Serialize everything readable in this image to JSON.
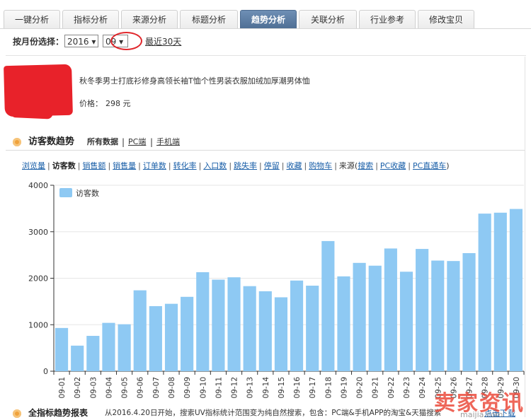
{
  "tabs": [
    {
      "label": "一键分析",
      "active": false
    },
    {
      "label": "指标分析",
      "active": false
    },
    {
      "label": "来源分析",
      "active": false
    },
    {
      "label": "标题分析",
      "active": false
    },
    {
      "label": "趋势分析",
      "active": true
    },
    {
      "label": "关联分析",
      "active": false
    },
    {
      "label": "行业参考",
      "active": false
    },
    {
      "label": "修改宝贝",
      "active": false
    }
  ],
  "month_select": {
    "label": "按月份选择：",
    "year": "2016",
    "month": "09",
    "recent_link": "最近30天"
  },
  "product": {
    "title": "秋冬季男士打底衫修身高领长袖T恤个性男装衣服加绒加厚潮男体恤",
    "price_label": "价格：",
    "price": "298 元"
  },
  "section": {
    "title": "访客数趋势",
    "segments": [
      {
        "label": "所有数据",
        "active": true
      },
      {
        "label": "PC端",
        "active": false
      },
      {
        "label": "手机端",
        "active": false
      }
    ]
  },
  "metrics": {
    "items": [
      {
        "label": "浏览量",
        "current": false
      },
      {
        "label": "访客数",
        "current": true
      },
      {
        "label": "销售额",
        "current": false
      },
      {
        "label": "销售量",
        "current": false
      },
      {
        "label": "订单数",
        "current": false
      },
      {
        "label": "转化率",
        "current": false
      },
      {
        "label": "入口数",
        "current": false
      },
      {
        "label": "跳失率",
        "current": false
      },
      {
        "label": "停留",
        "current": false
      },
      {
        "label": "收藏",
        "current": false
      },
      {
        "label": "购物车",
        "current": false
      }
    ],
    "source_prefix": "来源(",
    "source_items": [
      "搜索",
      "PC收藏",
      "PC直通车"
    ],
    "source_suffix": ")"
  },
  "chart_data": {
    "type": "bar",
    "series": [
      {
        "name": "访客数",
        "color": "#8ec9f3",
        "values": [
          930,
          550,
          760,
          1040,
          1010,
          1740,
          1400,
          1450,
          1600,
          2130,
          1970,
          2020,
          1830,
          1720,
          1590,
          1950,
          1840,
          2800,
          2040,
          2330,
          2270,
          2640,
          2140,
          2630,
          2380,
          2370,
          2540,
          3390,
          3410,
          3490
        ]
      }
    ],
    "categories": [
      "09-01",
      "09-02",
      "09-03",
      "09-04",
      "09-05",
      "09-06",
      "09-07",
      "09-08",
      "09-09",
      "09-10",
      "09-11",
      "09-12",
      "09-13",
      "09-14",
      "09-15",
      "09-16",
      "09-17",
      "09-18",
      "09-19",
      "09-20",
      "09-21",
      "09-22",
      "09-23",
      "09-24",
      "09-25",
      "09-26",
      "09-27",
      "09-28",
      "09-29",
      "09-30"
    ],
    "ylim": [
      0,
      4000
    ],
    "yticks": [
      0,
      1000,
      2000,
      3000,
      4000
    ],
    "grid": true,
    "legend": "top-left"
  },
  "bottom": {
    "title": "全指标趋势报表",
    "note": "从2016.4.20日开始，搜索UV指标统计范围变为纯自然搜索，包含：PC端&手机APP的淘宝&天猫搜索",
    "link": "点击下载"
  },
  "watermark": {
    "text": "卖家资讯",
    "url": "maijia.com"
  }
}
